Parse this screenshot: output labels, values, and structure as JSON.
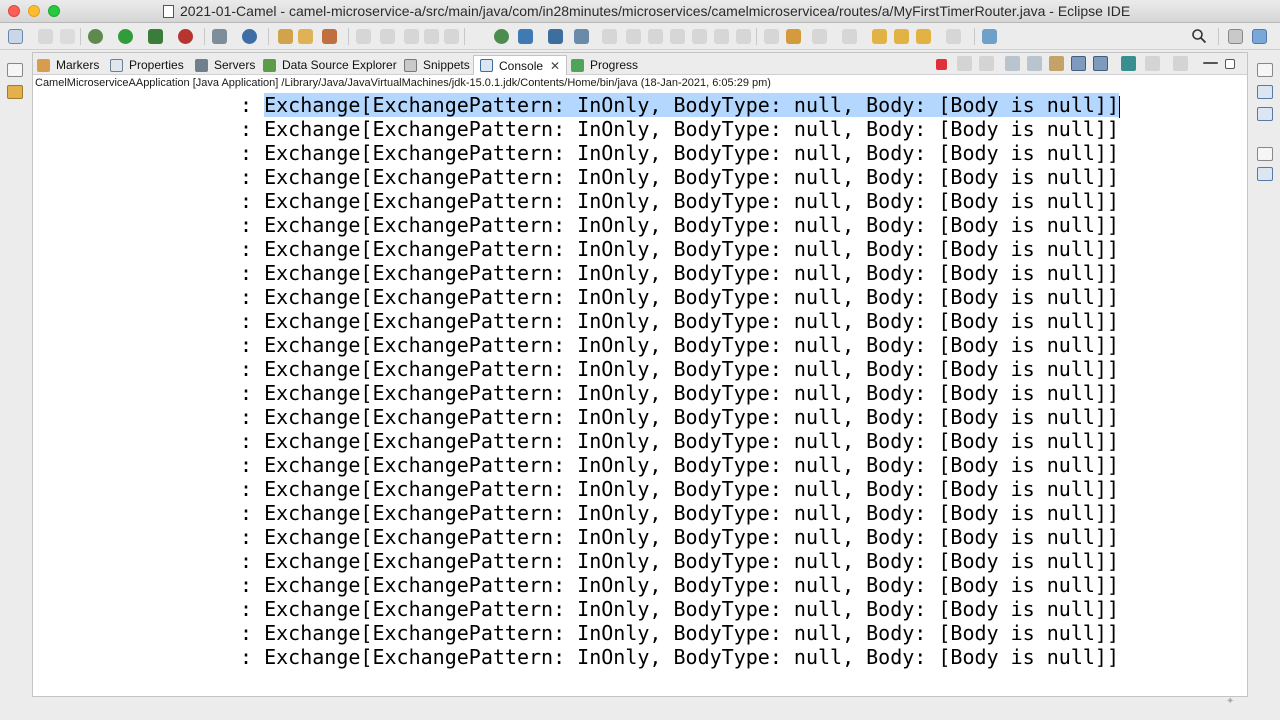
{
  "window": {
    "title": "2021-01-Camel - camel-microservice-a/src/main/java/com/in28minutes/microservices/camelmicroservicea/routes/a/MyFirstTimerRouter.java - Eclipse IDE"
  },
  "tabs": [
    {
      "label": "Markers",
      "icon": "markers-icon"
    },
    {
      "label": "Properties",
      "icon": "properties-icon"
    },
    {
      "label": "Servers",
      "icon": "servers-icon"
    },
    {
      "label": "Data Source Explorer",
      "icon": "data-source-icon"
    },
    {
      "label": "Snippets",
      "icon": "snippets-icon"
    },
    {
      "label": "Console",
      "icon": "console-icon",
      "active": true
    },
    {
      "label": "Progress",
      "icon": "progress-icon"
    }
  ],
  "console": {
    "description": "CamelMicroserviceAApplication [Java Application] /Library/Java/JavaVirtualMachines/jdk-15.0.1.jdk/Contents/Home/bin/java  (18-Jan-2021, 6:05:29 pm)",
    "prefix": ": ",
    "lines": [
      "Exchange[ExchangePattern: InOnly, BodyType: null, Body: [Body is null]]",
      "Exchange[ExchangePattern: InOnly, BodyType: null, Body: [Body is null]]",
      "Exchange[ExchangePattern: InOnly, BodyType: null, Body: [Body is null]]",
      "Exchange[ExchangePattern: InOnly, BodyType: null, Body: [Body is null]]",
      "Exchange[ExchangePattern: InOnly, BodyType: null, Body: [Body is null]]",
      "Exchange[ExchangePattern: InOnly, BodyType: null, Body: [Body is null]]",
      "Exchange[ExchangePattern: InOnly, BodyType: null, Body: [Body is null]]",
      "Exchange[ExchangePattern: InOnly, BodyType: null, Body: [Body is null]]",
      "Exchange[ExchangePattern: InOnly, BodyType: null, Body: [Body is null]]",
      "Exchange[ExchangePattern: InOnly, BodyType: null, Body: [Body is null]]",
      "Exchange[ExchangePattern: InOnly, BodyType: null, Body: [Body is null]]",
      "Exchange[ExchangePattern: InOnly, BodyType: null, Body: [Body is null]]",
      "Exchange[ExchangePattern: InOnly, BodyType: null, Body: [Body is null]]",
      "Exchange[ExchangePattern: InOnly, BodyType: null, Body: [Body is null]]",
      "Exchange[ExchangePattern: InOnly, BodyType: null, Body: [Body is null]]",
      "Exchange[ExchangePattern: InOnly, BodyType: null, Body: [Body is null]]",
      "Exchange[ExchangePattern: InOnly, BodyType: null, Body: [Body is null]]",
      "Exchange[ExchangePattern: InOnly, BodyType: null, Body: [Body is null]]",
      "Exchange[ExchangePattern: InOnly, BodyType: null, Body: [Body is null]]",
      "Exchange[ExchangePattern: InOnly, BodyType: null, Body: [Body is null]]",
      "Exchange[ExchangePattern: InOnly, BodyType: null, Body: [Body is null]]",
      "Exchange[ExchangePattern: InOnly, BodyType: null, Body: [Body is null]]",
      "Exchange[ExchangePattern: InOnly, BodyType: null, Body: [Body is null]]",
      "Exchange[ExchangePattern: InOnly, BodyType: null, Body: [Body is null]]"
    ],
    "selected_line": 0
  },
  "colors": {
    "selection": "#b3d7ff",
    "terminate": "#e0303a"
  }
}
